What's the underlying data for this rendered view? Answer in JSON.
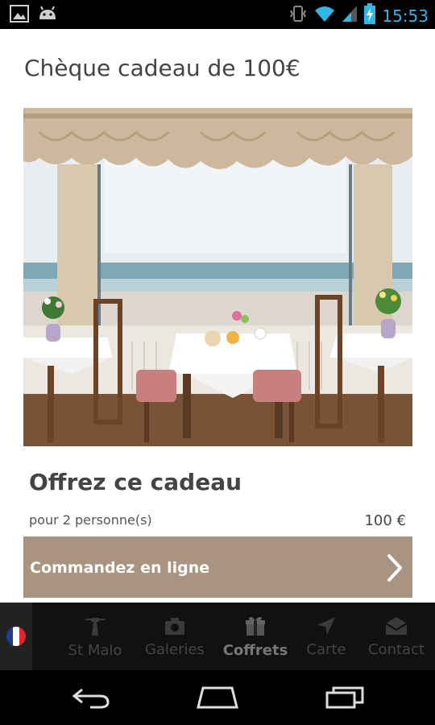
{
  "status_bar": {
    "time": "15:53",
    "icons": [
      "gallery-icon",
      "android-icon",
      "vibrate-icon",
      "wifi-icon",
      "signal-icon",
      "battery-charging-icon"
    ]
  },
  "page": {
    "title": "Chèque cadeau de 100€",
    "offer_title": "Offrez ce cadeau",
    "persons_label": "pour 2 personne(s)",
    "price": "100 €",
    "order_button_label": "Commandez en ligne"
  },
  "tab_bar": {
    "language_flag": "fr",
    "tabs": [
      {
        "label": "St Malo",
        "icon": "lighthouse-icon",
        "active": false
      },
      {
        "label": "Galeries",
        "icon": "camera-icon",
        "active": false
      },
      {
        "label": "Coffrets",
        "icon": "gift-icon",
        "active": true
      },
      {
        "label": "Carte",
        "icon": "navigation-arrow-icon",
        "active": false
      },
      {
        "label": "Contact",
        "icon": "envelope-icon",
        "active": false
      }
    ]
  },
  "colors": {
    "accent": "#33b5e5",
    "button": "#a99482",
    "flag_blue": "#1f3b95",
    "flag_red": "#e0252a"
  }
}
